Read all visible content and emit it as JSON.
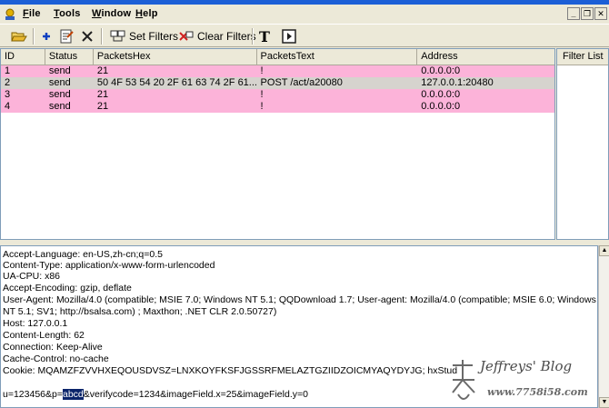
{
  "menu": {
    "items": [
      {
        "key": "F",
        "rest": "ile"
      },
      {
        "key": "T",
        "rest": "ools"
      },
      {
        "key": "W",
        "rest": "indow"
      },
      {
        "key": "H",
        "rest": "elp"
      }
    ],
    "minimize": "_",
    "restore": "❐",
    "close": "✕"
  },
  "toolbar": {
    "set_filters": "Set Filters",
    "clear_filters": "Clear Filters",
    "text_tool": "T"
  },
  "grid": {
    "columns": [
      "ID",
      "Status",
      "PacketsHex",
      "PacketsText",
      "Address"
    ],
    "rows": [
      {
        "id": "1",
        "status": "send",
        "hex": "21",
        "text": "!",
        "address": "0.0.0.0:0"
      },
      {
        "id": "2",
        "status": "send",
        "hex": "50 4F 53 54 20 2F 61 63 74 2F 61...",
        "text": "POST /act/a20080",
        "address": "127.0.0.1:20480"
      },
      {
        "id": "3",
        "status": "send",
        "hex": "21",
        "text": "!",
        "address": "0.0.0.0:0"
      },
      {
        "id": "4",
        "status": "send",
        "hex": "21",
        "text": "!",
        "address": "0.0.0.0:0"
      }
    ]
  },
  "filter_panel": {
    "title": "Filter List"
  },
  "detail": {
    "lines": [
      "Accept-Language: en-US,zh-cn;q=0.5",
      "Content-Type: application/x-www-form-urlencoded",
      "UA-CPU: x86",
      "Accept-Encoding: gzip, deflate",
      "User-Agent: Mozilla/4.0 (compatible; MSIE 7.0; Windows NT 5.1; QQDownload 1.7; User-agent: Mozilla/4.0 (compatible; MSIE 6.0; Windows",
      "NT 5.1; SV1; http://bsalsa.com) ; Maxthon; .NET CLR 2.0.50727)",
      "Host: 127.0.0.1",
      "Content-Length: 62",
      "Connection: Keep-Alive",
      "Cache-Control: no-cache",
      "Cookie: MQAMZFZVVHXEQOUSDVSZ=LNXKOYFKSFJGSSRFMELAZTGZIIDZOICMYAQYDYJG; hxStud"
    ],
    "body_before": "u=123456&p=",
    "body_selected": "abcd",
    "body_after": "&verifycode=1234&imageField.x=25&imageField.y=0"
  },
  "watermark": {
    "title": "Jeffreys' Blog",
    "url": "www.7758i58.com"
  },
  "colors": {
    "row_pink": "#fcb3d9",
    "row_gray": "#d6d3ce",
    "selection": "#0a246a"
  }
}
